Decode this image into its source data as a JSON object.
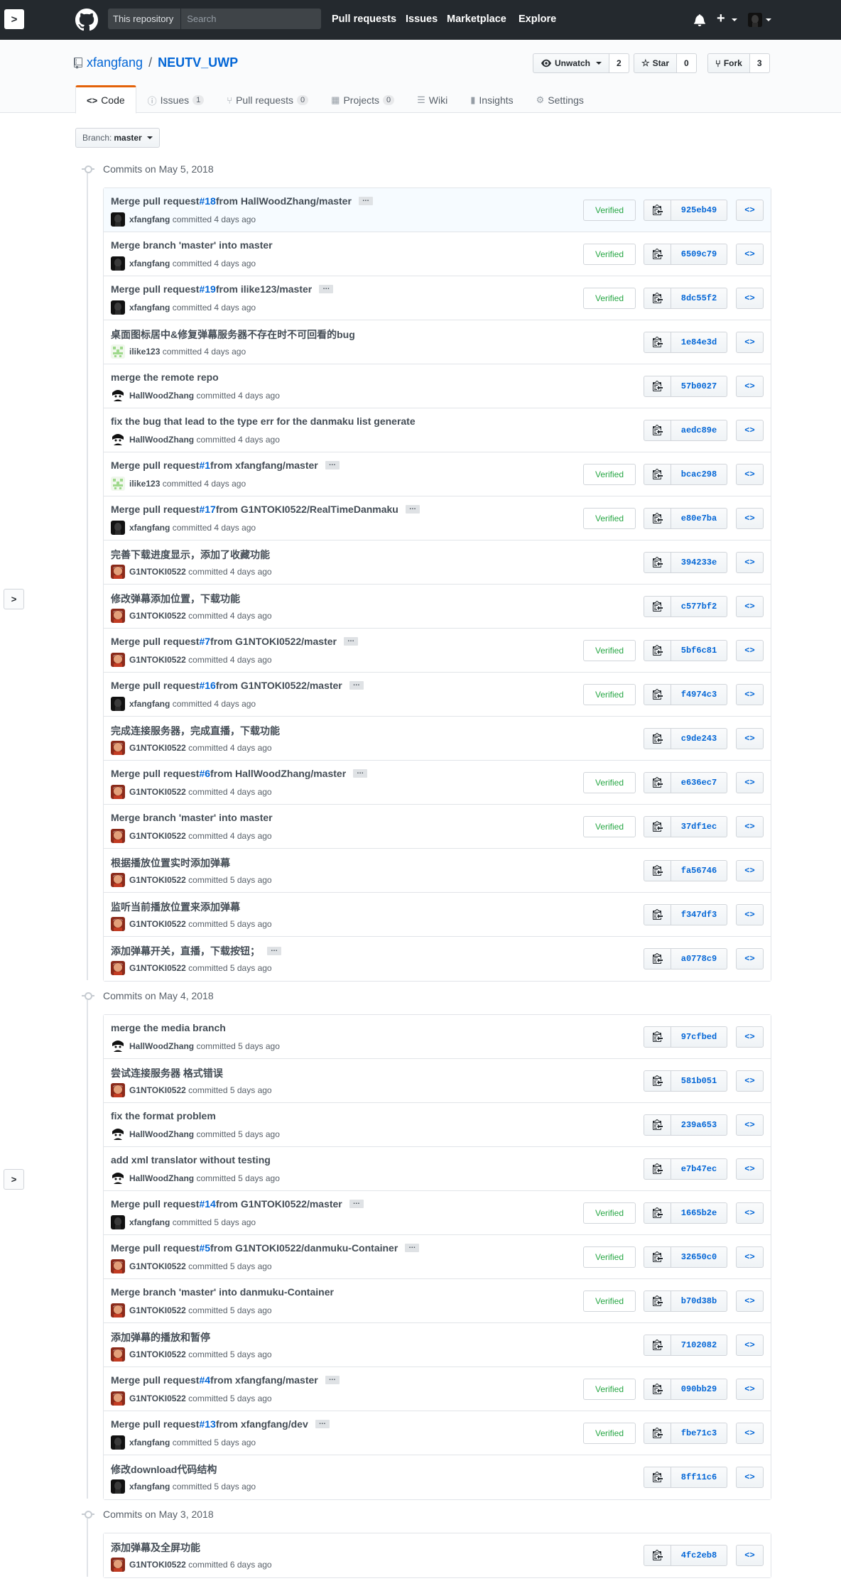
{
  "header": {
    "expander": ">",
    "search_scope": "This repository",
    "search_placeholder": "Search",
    "nav": [
      "Pull requests",
      "Issues",
      "Marketplace",
      "Explore"
    ],
    "plus": "+"
  },
  "repo": {
    "owner": "xfangfang",
    "sep": "/",
    "name": "NEUTV_UWP",
    "watch_label": "Unwatch",
    "watch_count": "2",
    "star_label": "Star",
    "star_count": "0",
    "fork_label": "Fork",
    "fork_count": "3"
  },
  "tabs": [
    {
      "icon": "<>",
      "label": "Code",
      "selected": true
    },
    {
      "icon": "ⓘ",
      "label": "Issues",
      "count": "1"
    },
    {
      "icon": "⑂",
      "label": "Pull requests",
      "count": "0"
    },
    {
      "icon": "▦",
      "label": "Projects",
      "count": "0"
    },
    {
      "icon": "☰",
      "label": "Wiki"
    },
    {
      "icon": "▮",
      "label": "Insights"
    },
    {
      "icon": "⚙",
      "label": "Settings"
    }
  ],
  "branch": {
    "label": "Branch:",
    "value": "master"
  },
  "labels": {
    "committed": "committed",
    "verified": "Verified",
    "browse": "<>",
    "side_expander": ">"
  },
  "groups": [
    {
      "title": "Commits on May 5, 2018",
      "commits": [
        {
          "pre": "Merge pull request ",
          "pr": "#18",
          "post": " from HallWoodZhang/master",
          "ellipsis": true,
          "author": "xfangfang",
          "time": "4 days ago",
          "verified": true,
          "sha": "925eb49",
          "av": "xf",
          "hi": true
        },
        {
          "pre": "Merge branch 'master' into master",
          "author": "xfangfang",
          "time": "4 days ago",
          "verified": true,
          "sha": "6509c79",
          "av": "xf"
        },
        {
          "pre": "Merge pull request ",
          "pr": "#19",
          "post": " from ilike123/master",
          "ellipsis": true,
          "author": "xfangfang",
          "time": "4 days ago",
          "verified": true,
          "sha": "8dc55f2",
          "av": "xf"
        },
        {
          "pre": "桌面图标居中&修复弹幕服务器不存在时不可回看的bug",
          "author": "ilike123",
          "time": "4 days ago",
          "sha": "1e84e3d",
          "av": "il"
        },
        {
          "pre": "merge the remote repo",
          "author": "HallWoodZhang",
          "time": "4 days ago",
          "sha": "57b0027",
          "av": "hw"
        },
        {
          "pre": "fix the bug that lead to the type err for the danmaku list generate",
          "author": "HallWoodZhang",
          "time": "4 days ago",
          "sha": "aedc89e",
          "av": "hw"
        },
        {
          "pre": "Merge pull request ",
          "pr": "#1",
          "post": " from xfangfang/master",
          "ellipsis": true,
          "author": "ilike123",
          "time": "4 days ago",
          "verified": true,
          "sha": "bcac298",
          "av": "il"
        },
        {
          "pre": "Merge pull request ",
          "pr": "#17",
          "post": " from G1NTOKI0522/RealTimeDanmaku",
          "ellipsis": true,
          "author": "xfangfang",
          "time": "4 days ago",
          "verified": true,
          "sha": "e80e7ba",
          "av": "xf"
        },
        {
          "pre": "完善下载进度显示，添加了收藏功能",
          "author": "G1NTOKI0522",
          "time": "4 days ago",
          "sha": "394233e",
          "av": "g1"
        },
        {
          "pre": "修改弹幕添加位置，下载功能",
          "author": "G1NTOKI0522",
          "time": "4 days ago",
          "sha": "c577bf2",
          "av": "g1"
        },
        {
          "pre": "Merge pull request ",
          "pr": "#7",
          "post": " from G1NTOKI0522/master",
          "ellipsis": true,
          "author": "G1NTOKI0522",
          "time": "4 days ago",
          "verified": true,
          "sha": "5bf6c81",
          "av": "g1"
        },
        {
          "pre": "Merge pull request ",
          "pr": "#16",
          "post": " from G1NTOKI0522/master",
          "ellipsis": true,
          "author": "xfangfang",
          "time": "4 days ago",
          "verified": true,
          "sha": "f4974c3",
          "av": "xf"
        },
        {
          "pre": "完成连接服务器，完成直播，下载功能",
          "author": "G1NTOKI0522",
          "time": "4 days ago",
          "sha": "c9de243",
          "av": "g1"
        },
        {
          "pre": "Merge pull request ",
          "pr": "#6",
          "post": " from HallWoodZhang/master",
          "ellipsis": true,
          "author": "G1NTOKI0522",
          "time": "4 days ago",
          "verified": true,
          "sha": "e636ec7",
          "av": "g1"
        },
        {
          "pre": "Merge branch 'master' into master",
          "author": "G1NTOKI0522",
          "time": "4 days ago",
          "verified": true,
          "sha": "37df1ec",
          "av": "g1"
        },
        {
          "pre": "根据播放位置实时添加弹幕",
          "author": "G1NTOKI0522",
          "time": "5 days ago",
          "sha": "fa56746",
          "av": "g1"
        },
        {
          "pre": "监听当前播放位置来添加弹幕",
          "author": "G1NTOKI0522",
          "time": "5 days ago",
          "sha": "f347df3",
          "av": "g1"
        },
        {
          "pre": "添加弹幕开关，直播，下载按钮；",
          "ellipsis": true,
          "author": "G1NTOKI0522",
          "time": "5 days ago",
          "sha": "a0778c9",
          "av": "g1"
        }
      ]
    },
    {
      "title": "Commits on May 4, 2018",
      "commits": [
        {
          "pre": "merge the media branch",
          "author": "HallWoodZhang",
          "time": "5 days ago",
          "sha": "97cfbed",
          "av": "hw"
        },
        {
          "pre": "尝试连接服务器 格式错误",
          "author": "G1NTOKI0522",
          "time": "5 days ago",
          "sha": "581b051",
          "av": "g1"
        },
        {
          "pre": "fix the format problem",
          "author": "HallWoodZhang",
          "time": "5 days ago",
          "sha": "239a653",
          "av": "hw"
        },
        {
          "pre": "add xml translator without testing",
          "author": "HallWoodZhang",
          "time": "5 days ago",
          "sha": "e7b47ec",
          "av": "hw"
        },
        {
          "pre": "Merge pull request ",
          "pr": "#14",
          "post": " from G1NTOKI0522/master",
          "ellipsis": true,
          "author": "xfangfang",
          "time": "5 days ago",
          "verified": true,
          "sha": "1665b2e",
          "av": "xf"
        },
        {
          "pre": "Merge pull request ",
          "pr": "#5",
          "post": " from G1NTOKI0522/danmuku-Container",
          "ellipsis": true,
          "author": "G1NTOKI0522",
          "time": "5 days ago",
          "verified": true,
          "sha": "32650c0",
          "av": "g1"
        },
        {
          "pre": "Merge branch 'master' into danmuku-Container",
          "author": "G1NTOKI0522",
          "time": "5 days ago",
          "verified": true,
          "sha": "b70d38b",
          "av": "g1"
        },
        {
          "pre": "添加弹幕的播放和暂停",
          "author": "G1NTOKI0522",
          "time": "5 days ago",
          "sha": "7102082",
          "av": "g1"
        },
        {
          "pre": "Merge pull request ",
          "pr": "#4",
          "post": " from xfangfang/master",
          "ellipsis": true,
          "author": "G1NTOKI0522",
          "time": "5 days ago",
          "verified": true,
          "sha": "090bb29",
          "av": "g1"
        },
        {
          "pre": "Merge pull request ",
          "pr": "#13",
          "post": " from xfangfang/dev",
          "ellipsis": true,
          "author": "xfangfang",
          "time": "5 days ago",
          "verified": true,
          "sha": "fbe71c3",
          "av": "xf"
        },
        {
          "pre": "修改download代码结构",
          "author": "xfangfang",
          "time": "5 days ago",
          "sha": "8ff11c6",
          "av": "xf"
        }
      ]
    },
    {
      "title": "Commits on May 3, 2018",
      "commits": [
        {
          "pre": "添加弹幕及全屏功能",
          "author": "G1NTOKI0522",
          "time": "6 days ago",
          "sha": "4fc2eb8",
          "av": "g1"
        }
      ]
    }
  ]
}
